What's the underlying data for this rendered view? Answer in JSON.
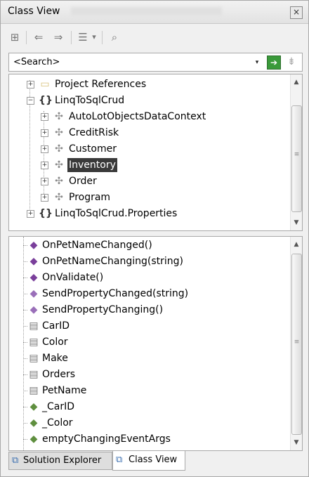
{
  "window": {
    "title": "Class View",
    "close_glyph": "×"
  },
  "toolbar": {
    "buttons": [
      {
        "name": "new-folder-icon",
        "glyph": "⊞"
      },
      {
        "name": "back-icon",
        "glyph": "⇐"
      },
      {
        "name": "forward-icon",
        "glyph": "⇒"
      },
      {
        "name": "view-settings-icon",
        "glyph": "☰"
      },
      {
        "name": "view-settings-dropdown-icon",
        "glyph": "▾"
      },
      {
        "name": "find-symbol-icon",
        "glyph": "⌕"
      }
    ]
  },
  "search": {
    "value": "<Search>",
    "dropdown_glyph": "▾",
    "go_glyph": "➔",
    "clear_glyph": "⇟"
  },
  "tree": {
    "items": [
      {
        "label": "Project References",
        "icon": "folder-icon",
        "glyph": "▭",
        "color": "#d8c27a"
      },
      {
        "label": "LinqToSqlCrud",
        "icon": "namespace-icon",
        "glyph": "{}",
        "color": "#333333"
      },
      {
        "label": "AutoLotObjectsDataContext",
        "icon": "class-icon",
        "glyph": "✣",
        "color": "#8a8a8a"
      },
      {
        "label": "CreditRisk",
        "icon": "class-icon",
        "glyph": "✣",
        "color": "#8a8a8a"
      },
      {
        "label": "Customer",
        "icon": "class-icon",
        "glyph": "✣",
        "color": "#8a8a8a"
      },
      {
        "label": "Inventory",
        "icon": "class-icon",
        "glyph": "✣",
        "color": "#8a8a8a"
      },
      {
        "label": "Order",
        "icon": "class-icon",
        "glyph": "✣",
        "color": "#8a8a8a"
      },
      {
        "label": "Program",
        "icon": "class-icon",
        "glyph": "✣",
        "color": "#8a8a8a"
      },
      {
        "label": "LinqToSqlCrud.Properties",
        "icon": "namespace-icon",
        "glyph": "{}",
        "color": "#333333"
      }
    ],
    "selected": "Inventory",
    "expander_plus": "+",
    "expander_minus": "−"
  },
  "members": {
    "items": [
      {
        "label": "OnPetNameChanged()",
        "icon": "private-method-icon",
        "glyph": "◆"
      },
      {
        "label": "OnPetNameChanging(string)",
        "icon": "private-method-icon",
        "glyph": "◆"
      },
      {
        "label": "OnValidate()",
        "icon": "private-method-icon",
        "glyph": "◆"
      },
      {
        "label": "SendPropertyChanged(string)",
        "icon": "protected-method-icon",
        "glyph": "◆"
      },
      {
        "label": "SendPropertyChanging()",
        "icon": "protected-method-icon",
        "glyph": "◆"
      },
      {
        "label": "CarID",
        "icon": "property-icon",
        "glyph": "▤"
      },
      {
        "label": "Color",
        "icon": "property-icon",
        "glyph": "▤"
      },
      {
        "label": "Make",
        "icon": "property-icon",
        "glyph": "▤"
      },
      {
        "label": "Orders",
        "icon": "property-icon",
        "glyph": "▤"
      },
      {
        "label": "PetName",
        "icon": "property-icon",
        "glyph": "▤"
      },
      {
        "label": "_CarID",
        "icon": "private-field-icon",
        "glyph": "◆"
      },
      {
        "label": "_Color",
        "icon": "private-field-icon",
        "glyph": "◆"
      },
      {
        "label": "emptyChangingEventArgs",
        "icon": "private-field-icon",
        "glyph": "◆"
      }
    ]
  },
  "tabs": [
    {
      "label": "Solution Explorer",
      "icon": "solution-explorer-icon",
      "glyph": "⧉",
      "active": false
    },
    {
      "label": "Class View",
      "icon": "class-view-icon",
      "glyph": "⧉",
      "active": true
    }
  ],
  "scroll_arrows": {
    "up": "▲",
    "down": "▼",
    "grip": "≡"
  }
}
